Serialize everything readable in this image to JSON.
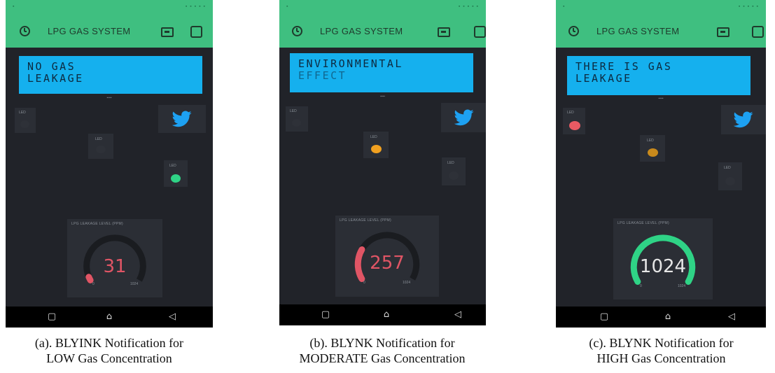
{
  "app": {
    "title": "LPG GAS SYSTEM"
  },
  "icons": {
    "clock": "clock-icon",
    "board": "device-board-icon",
    "square": "square-icon",
    "twitter": "twitter-bird-icon",
    "nav_square": "recent-apps-icon",
    "nav_home": "home-icon",
    "nav_back": "back-icon"
  },
  "colors": {
    "header": "#3fbf80",
    "lcd": "#15b0ee",
    "background": "#212329",
    "widget": "#2b2e35",
    "led_red": "#e85a63",
    "led_orange": "#f0a020",
    "led_green": "#2fd386",
    "gauge_red": "#e05565",
    "gauge_green": "#2fd386",
    "gauge_track": "#1a1c20"
  },
  "nav": {
    "square": "▢",
    "home": "⌂",
    "back": "◁"
  },
  "panels": [
    {
      "lcd_line1": "NO GAS",
      "lcd_line2": "LEAKAGE",
      "led_label": "LED",
      "led_states": {
        "red": "off",
        "orange": "off",
        "green": "on"
      },
      "gauge": {
        "title": "LPG LEAKAGE LEVEL (PPM)",
        "value": "31",
        "value_number": 31,
        "min": "0",
        "max": "1024"
      },
      "caption_line1": "(a). BLYINK Notification for",
      "caption_line2": "LOW Gas Concentration"
    },
    {
      "lcd_line1": "ENVIRONMENTAL",
      "lcd_line2": "EFFECT",
      "led_label": "LED",
      "led_states": {
        "red": "off",
        "orange": "on",
        "green": "off"
      },
      "gauge": {
        "title": "LPG LEAKAGE LEVEL (PPM)",
        "value": "257",
        "value_number": 257,
        "min": "0",
        "max": "1024"
      },
      "caption_line1": "(b). BLYNK Notification for",
      "caption_line2": "MODERATE Gas Concentration"
    },
    {
      "lcd_line1": "THERE IS GAS",
      "lcd_line2": "LEAKAGE",
      "led_label": "LED",
      "led_states": {
        "red": "on",
        "orange": "on",
        "green": "off"
      },
      "gauge": {
        "title": "LPG LEAKAGE LEVEL (PPM)",
        "value": "1024",
        "value_number": 1024,
        "min": "0",
        "max": "1024"
      },
      "caption_line1": "(c). BLYNK Notification for",
      "caption_line2": "HIGH Gas Concentration"
    }
  ]
}
